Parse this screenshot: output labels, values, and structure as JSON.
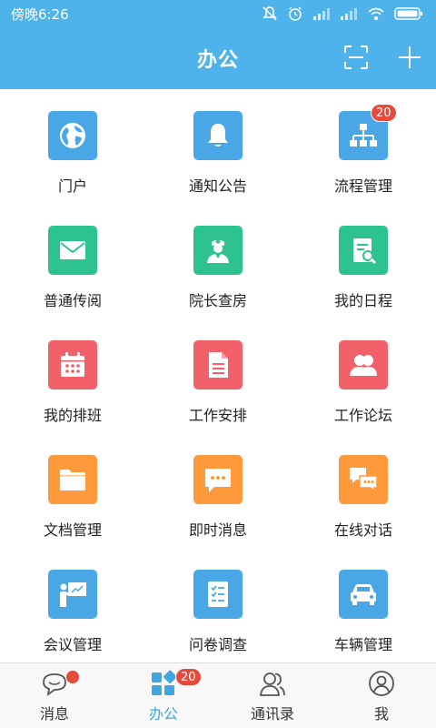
{
  "status_bar": {
    "time": "傍晚6:26"
  },
  "header": {
    "title": "办公"
  },
  "grid": [
    {
      "label": "门户",
      "icon": "globe-icon",
      "color": "#4aa7e6"
    },
    {
      "label": "通知公告",
      "icon": "bell-icon",
      "color": "#4aa7e6"
    },
    {
      "label": "流程管理",
      "icon": "org-chart-icon",
      "color": "#4aa7e6",
      "badge": "20"
    },
    {
      "label": "普通传阅",
      "icon": "mail-icon",
      "color": "#2ec28e"
    },
    {
      "label": "院长查房",
      "icon": "doctor-icon",
      "color": "#2ec28e"
    },
    {
      "label": "我的日程",
      "icon": "schedule-doc-icon",
      "color": "#2ec28e"
    },
    {
      "label": "我的排班",
      "icon": "calendar-icon",
      "color": "#f2606a"
    },
    {
      "label": "工作安排",
      "icon": "document-icon",
      "color": "#f2606a"
    },
    {
      "label": "工作论坛",
      "icon": "people-icon",
      "color": "#f2606a"
    },
    {
      "label": "文档管理",
      "icon": "folder-icon",
      "color": "#ff9a3c"
    },
    {
      "label": "即时消息",
      "icon": "chat-bubble-icon",
      "color": "#ff9a3c"
    },
    {
      "label": "在线对话",
      "icon": "dialog-icon",
      "color": "#ff9a3c"
    },
    {
      "label": "会议管理",
      "icon": "presentation-icon",
      "color": "#4aa7e6"
    },
    {
      "label": "问卷调查",
      "icon": "checklist-icon",
      "color": "#4aa7e6"
    },
    {
      "label": "车辆管理",
      "icon": "car-icon",
      "color": "#4aa7e6"
    }
  ],
  "tabbar": [
    {
      "label": "消息",
      "icon": "message-icon",
      "dot": true
    },
    {
      "label": "办公",
      "icon": "office-grid-icon",
      "badge": "20",
      "active": true
    },
    {
      "label": "通讯录",
      "icon": "contacts-icon"
    },
    {
      "label": "我",
      "icon": "profile-icon"
    }
  ],
  "colors": {
    "header": "#4db3ea",
    "badge": "#e54b3c",
    "active_tab": "#3fa6e2"
  }
}
